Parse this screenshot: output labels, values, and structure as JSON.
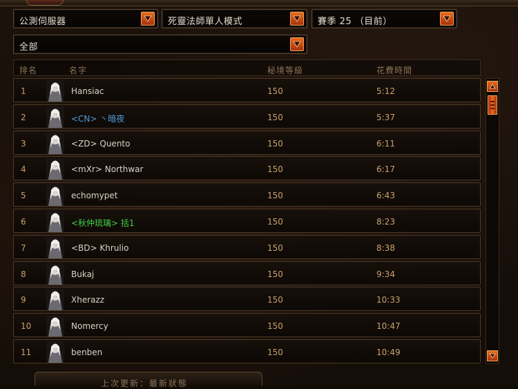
{
  "filters": {
    "server": "公測伺服器",
    "mode": "死靈法師單人模式",
    "season": "賽季 25 （目前）",
    "class_filter": "全部"
  },
  "table": {
    "columns": [
      "排名",
      "名字",
      "秘境等級",
      "花費時間"
    ],
    "rows": [
      {
        "rank": "1",
        "name": "Hansiac",
        "level": "150",
        "time": "5:12",
        "color": "#dcd3c6"
      },
      {
        "rank": "2",
        "name": "<CN> 丶暗夜",
        "level": "150",
        "time": "5:37",
        "color": "#4f9ad8"
      },
      {
        "rank": "3",
        "name": "<ZD> Quento",
        "level": "150",
        "time": "6:11",
        "color": "#dcd3c6"
      },
      {
        "rank": "4",
        "name": "<mXr> Northwar",
        "level": "150",
        "time": "6:17",
        "color": "#dcd3c6"
      },
      {
        "rank": "5",
        "name": "echomypet",
        "level": "150",
        "time": "6:43",
        "color": "#dcd3c6"
      },
      {
        "rank": "6",
        "name": "<秋仲琉璃> 括1",
        "level": "150",
        "time": "8:23",
        "color": "#3fd14a"
      },
      {
        "rank": "7",
        "name": "<BD> Khrulio",
        "level": "150",
        "time": "8:38",
        "color": "#dcd3c6"
      },
      {
        "rank": "8",
        "name": "Bukaj",
        "level": "150",
        "time": "9:34",
        "color": "#dcd3c6"
      },
      {
        "rank": "9",
        "name": "Xherazz",
        "level": "150",
        "time": "10:33",
        "color": "#dcd3c6"
      },
      {
        "rank": "10",
        "name": "Nomercy",
        "level": "150",
        "time": "10:47",
        "color": "#dcd3c6"
      },
      {
        "rank": "11",
        "name": "benben",
        "level": "150",
        "time": "10:49",
        "color": "#dcd3c6"
      }
    ]
  },
  "footer": {
    "last_updated": "上次更新：最新狀態"
  },
  "icons": {
    "dropdown": "chevron-down-icon",
    "scroll_up": "arrow-up-icon",
    "scroll_down": "arrow-down-icon",
    "avatar": "necromancer-portrait-icon"
  },
  "colors": {
    "accent": "#e56a1c",
    "text_gold": "#c9a26b",
    "clan_blue": "#4f9ad8",
    "clan_green": "#3fd14a"
  }
}
